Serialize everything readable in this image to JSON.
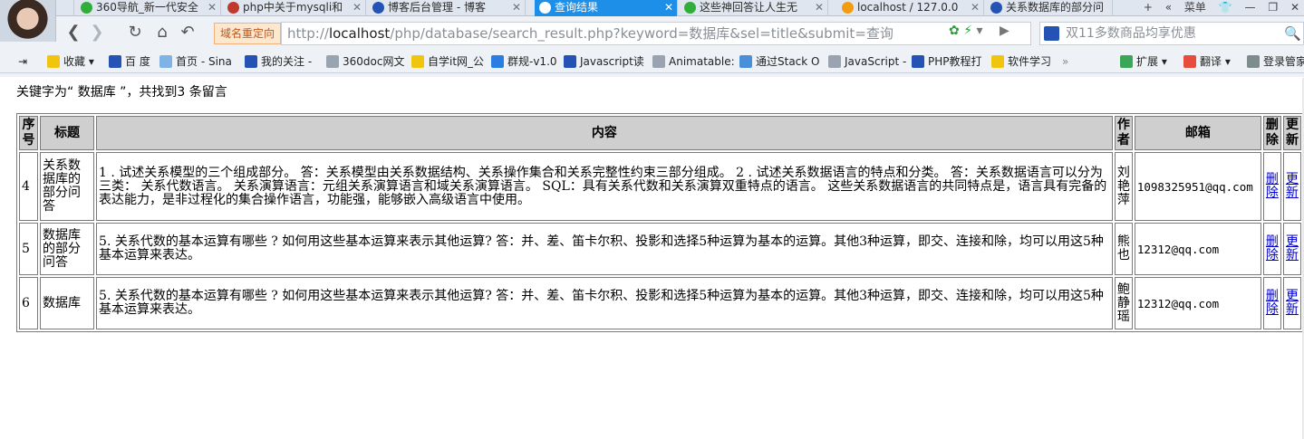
{
  "browser": {
    "tabs": [
      {
        "label": "360导航_新一代安全",
        "color": "#2fae3a",
        "active": false
      },
      {
        "label": "php中关于mysqli和",
        "color": "#c0392b",
        "active": false
      },
      {
        "label": "博客后台管理 - 博客",
        "color": "#2452b5",
        "active": false
      },
      {
        "label": "查询结果",
        "color": "#e74c3c",
        "active": true
      },
      {
        "label": "这些神回答让人生无",
        "color": "#2fae3a",
        "active": false
      },
      {
        "label": "localhost / 127.0.0",
        "color": "#f39c12",
        "active": false
      },
      {
        "label": "关系数据库的部分问",
        "color": "#2452b5",
        "active": false
      }
    ],
    "new_tab": "+",
    "menu_label": "菜单",
    "redirect_label": "域名重定向",
    "url_prefix": "http://",
    "url_host": "localhost",
    "url_rest": "/php/database/search_result.php?keyword=数据库&sel=title&submit=查询",
    "search_placeholder": "双11多数商品均享优惠",
    "bookmarks": [
      {
        "label": "收藏",
        "color": "#f1c40f"
      },
      {
        "label": "百 度",
        "color": "#2452b5"
      },
      {
        "label": "首页 - Sina",
        "color": "#7fb3e6"
      },
      {
        "label": "我的关注 -",
        "color": "#2452b5"
      },
      {
        "label": "360doc网文",
        "color": "#9aa4b0"
      },
      {
        "label": "自学it网_公",
        "color": "#f1c40f"
      },
      {
        "label": "群规-v1.0",
        "color": "#2a7de1"
      },
      {
        "label": "Javascript读",
        "color": "#2452b5"
      },
      {
        "label": "Animatable:",
        "color": "#9aa4b0"
      },
      {
        "label": "通过Stack O",
        "color": "#4a90d9"
      },
      {
        "label": "JavaScript -",
        "color": "#9aa4b0"
      },
      {
        "label": "PHP教程打",
        "color": "#2452b5"
      },
      {
        "label": "软件学习",
        "color": "#f1c40f"
      }
    ],
    "bookmarks_right": [
      {
        "label": "扩展",
        "color": "#3aa757"
      },
      {
        "label": "翻译",
        "color": "#e74c3c"
      },
      {
        "label": "登录管家",
        "color": "#7f8c8d"
      }
    ]
  },
  "page": {
    "summary": "关键字为“ 数据库 ”，共找到3 条留言",
    "headers": [
      "序号",
      "标题",
      "内容",
      "作者",
      "邮箱",
      "删除",
      "更新"
    ],
    "rows": [
      {
        "id": "4",
        "title": "关系数据库的部分问答",
        "content": "1 . 试述关系模型的三个组成部分。 答：关系模型由关系数据结构、关系操作集合和关系完整性约束三部分组成。 2 . 试述关系数据语言的特点和分类。 答：关系数据语言可以分为三类： 关系代数语言。 关系演算语言：元组关系演算语言和域关系演算语言。 SQL：具有关系代数和关系演算双重特点的语言。 这些关系数据语言的共同特点是，语言具有完备的表达能力，是非过程化的集合操作语言，功能强，能够嵌入高级语言中使用。",
        "author": "刘艳萍",
        "email": "1098325951@qq.com",
        "delete": "删除",
        "update": "更新"
      },
      {
        "id": "5",
        "title": "数据库的部分问答",
        "content": "5. 关系代数的基本运算有哪些 ? 如何用这些基本运算来表示其他运算? 答：并、差、笛卡尔积、投影和选择5种运算为基本的运算。其他3种运算，即交、连接和除，均可以用这5种基本运算来表达。",
        "author": "熊也",
        "email": "12312@qq.com",
        "delete": "删除",
        "update": "更新"
      },
      {
        "id": "6",
        "title": "数据库",
        "content": "5. 关系代数的基本运算有哪些 ? 如何用这些基本运算来表示其他运算? 答：并、差、笛卡尔积、投影和选择5种运算为基本的运算。其他3种运算，即交、连接和除，均可以用这5种基本运算来表达。",
        "author": "鲍静瑶",
        "email": "12312@qq.com",
        "delete": "删除",
        "update": "更新"
      }
    ]
  }
}
